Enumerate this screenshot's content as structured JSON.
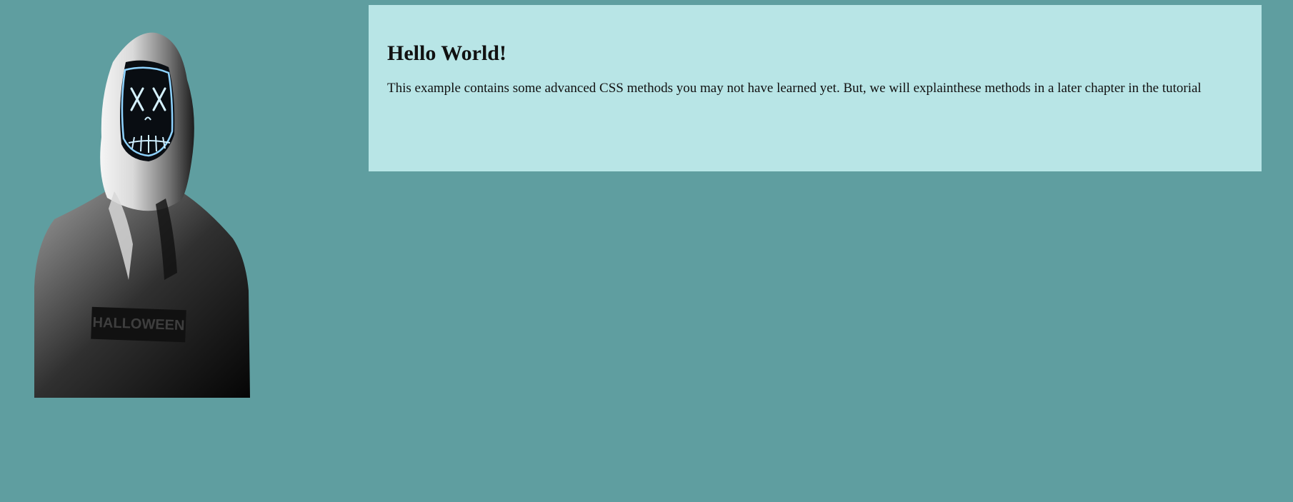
{
  "image": {
    "alt": "person in hoodie with glowing mask",
    "hoodie_text": "HALLOWEEN"
  },
  "content": {
    "heading": "Hello World!",
    "paragraph": "This example contains some advanced CSS methods you may not have learned yet. But, we will explainthese methods in a later chapter in the tutorial"
  },
  "colors": {
    "page_background": "#5f9ea0",
    "box_background": "#b8e5e6",
    "mask_glow": "#8fd3ff"
  }
}
